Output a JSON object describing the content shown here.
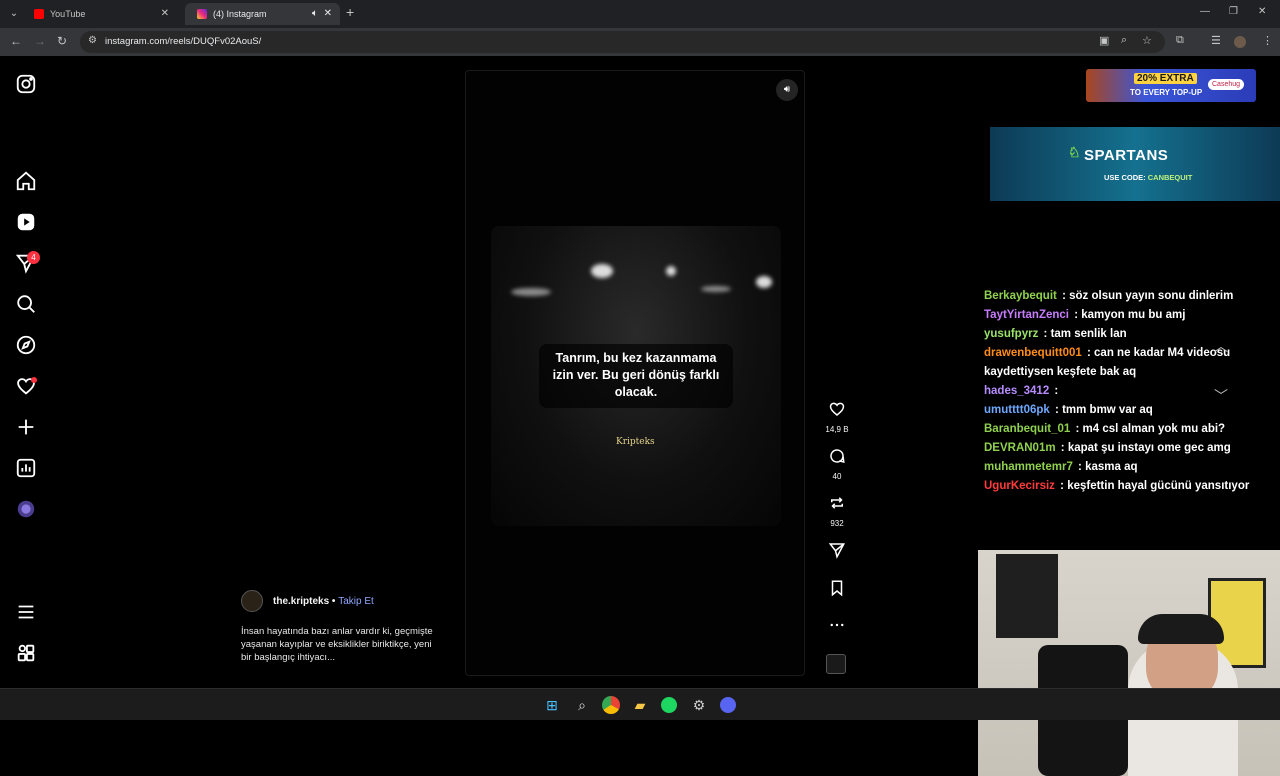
{
  "browser": {
    "tabs": [
      {
        "title": "YouTube",
        "active": false,
        "icon": "youtube-icon"
      },
      {
        "title": "(4) Instagram",
        "active": true,
        "icon": "instagram-icon"
      }
    ],
    "url": "instagram.com/reels/DUQFv02AouS/"
  },
  "sidebar": {
    "items": [
      "instagram-logo",
      "home",
      "reels",
      "messages",
      "search",
      "explore",
      "notifications",
      "create",
      "dashboard",
      "profile",
      "more",
      "also-from-meta"
    ],
    "messages_badge": "4"
  },
  "reel": {
    "caption_overlay": "Tanrım, bu kez kazanmama izin ver. Bu geri dönüş farklı olacak.",
    "watermark": "Kripteks",
    "likes": "14,9 B",
    "comments": "40",
    "reposts": "932",
    "author": "the.kripteks",
    "separator": "•",
    "follow_label": "Takip Et",
    "description": "İnsan hayatında bazı anlar vardır ki, geçmişte yaşanan kayıplar ve eksiklikler biriktikçe, yeni bir başlangıç ihtiyacı..."
  },
  "overlay": {
    "ad_line1": "20% EXTRA",
    "ad_line2": "TO EVERY TOP-UP",
    "ad_brand": "Casehug",
    "sponsor_brand": "SPARTANS",
    "sponsor_code_prefix": "USE CODE:",
    "sponsor_code": "CANBEQUIT"
  },
  "chat": [
    {
      "user": "Berkaybequit",
      "color": "#8fd14f",
      "msg": "söz olsun yayın sonu dinlerim"
    },
    {
      "user": "TaytYirtanZenci",
      "color": "#c77dff",
      "msg": "kamyon mu bu amj"
    },
    {
      "user": "yusufpyrz",
      "color": "#9be36b",
      "msg": "tam senlik lan"
    },
    {
      "user": "drawenbequitt001",
      "color": "#ff8c1a",
      "msg": "can ne kadar M4 videosu kaydettiysen keşfete bak aq"
    },
    {
      "user": "hades_3412",
      "color": "#b78cff",
      "msg": ""
    },
    {
      "user": "umutttt06pk",
      "color": "#6fa8ff",
      "msg": "tmm bmw var aq"
    },
    {
      "user": "Baranbequit_01",
      "color": "#8fd14f",
      "msg": "m4 csl alman yok mu abi?"
    },
    {
      "user": "DEVRAN01m",
      "color": "#8fd14f",
      "msg": "kapat şu instayı ome gec amg"
    },
    {
      "user": "muhammetemr7",
      "color": "#8fd14f",
      "msg": "kasma aq"
    },
    {
      "user": "UgurKecirsiz",
      "color": "#ff3b3b",
      "msg": "keşfettin hayal gücünü yansıtıyor"
    }
  ],
  "chat_separator": ":",
  "colors": {
    "accent": "#8fa6ff",
    "badge": "#ff3040"
  }
}
